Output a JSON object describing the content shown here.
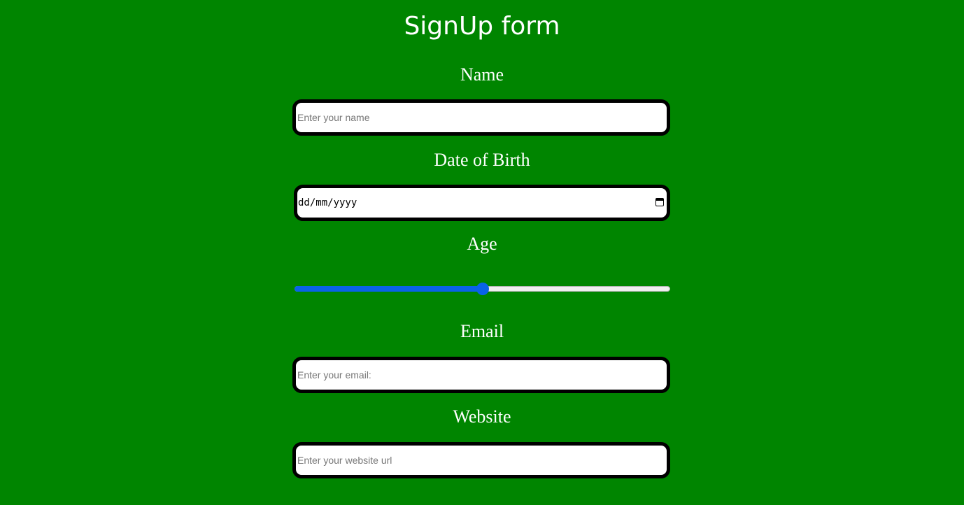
{
  "form": {
    "title": "SignUp form",
    "name": {
      "label": "Name",
      "placeholder": "Enter your name"
    },
    "dob": {
      "label": "Date of Birth",
      "placeholder": "dd/mm/yyyy"
    },
    "age": {
      "label": "Age",
      "value_fraction": 0.5
    },
    "email": {
      "label": "Email",
      "placeholder": "Enter your email:"
    },
    "website": {
      "label": "Website",
      "placeholder": "Enter your website url"
    }
  },
  "colors": {
    "background": "#008500",
    "slider_accent": "#0a63e8"
  },
  "icons": {
    "date_picker": "calendar-icon"
  }
}
